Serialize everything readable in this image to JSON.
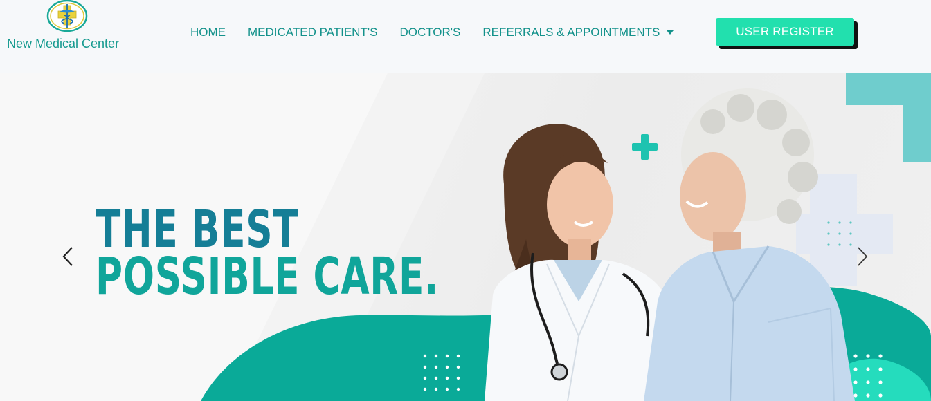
{
  "brand": {
    "name": "New Medical Center",
    "logo_icon": "caduceus-cross-icon",
    "colors": {
      "primary": "#12918a",
      "accent": "#22e0ae"
    }
  },
  "nav": {
    "items": [
      {
        "label": "HOME"
      },
      {
        "label": "MEDICATED PATIENT'S"
      },
      {
        "label": "DOCTOR'S"
      },
      {
        "label": "REFERRALS & APPOINTMENTS",
        "dropdown": true
      }
    ],
    "register_label": "USER REGISTER"
  },
  "hero": {
    "line1": "THE BEST",
    "line2": "POSSIBLE CARE.",
    "prev_icon": "chevron-left-icon",
    "next_icon": "chevron-right-icon"
  }
}
